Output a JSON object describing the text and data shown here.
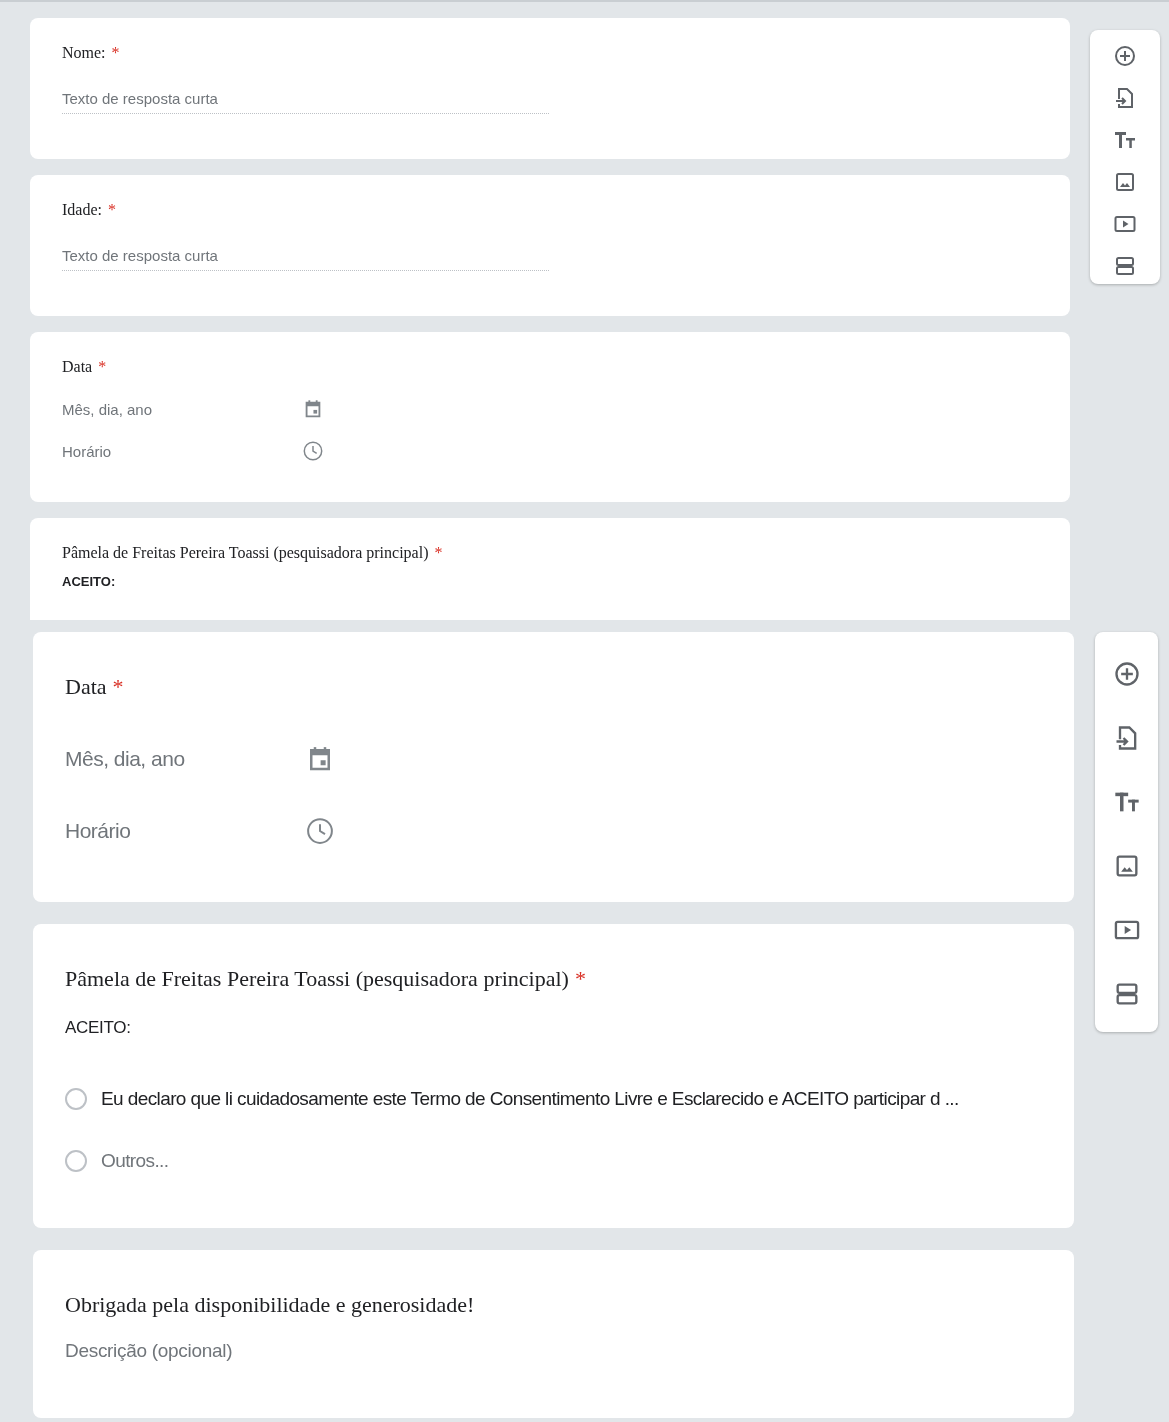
{
  "panels": [
    {
      "cards": [
        {
          "kind": "short_answer",
          "title": "Nome:",
          "required_mark": "*",
          "placeholder": "Texto de resposta curta"
        },
        {
          "kind": "short_answer",
          "title": "Idade:",
          "required_mark": "*",
          "placeholder": "Texto de resposta curta"
        },
        {
          "kind": "date",
          "title": "Data",
          "required_mark": "*",
          "date": "Mês, dia, ano",
          "time": "Horário"
        },
        {
          "kind": "choice",
          "title": "Pâmela de Freitas Pereira Toassi (pesquisadora principal)",
          "required_mark": "*",
          "description": "ACEITO:"
        }
      ]
    },
    {
      "cards": [
        {
          "kind": "date",
          "title": "Data",
          "required_mark": "*",
          "date": "Mês, dia, ano",
          "time": "Horário"
        },
        {
          "kind": "choice",
          "title": "Pâmela de Freitas Pereira Toassi (pesquisadora principal)",
          "required_mark": "*",
          "description": "ACEITO:",
          "options": [
            {
              "label": "Eu declaro que li cuidadosamente este Termo de Consentimento Livre e Esclarecido e ACEITO participar d ...",
              "selected": false
            },
            {
              "label": "Outros...",
              "selected": false
            }
          ]
        },
        {
          "kind": "title",
          "title": "Obrigada pela disponibilidade e generosidade!",
          "description": "Descrição (opcional)"
        }
      ]
    }
  ]
}
